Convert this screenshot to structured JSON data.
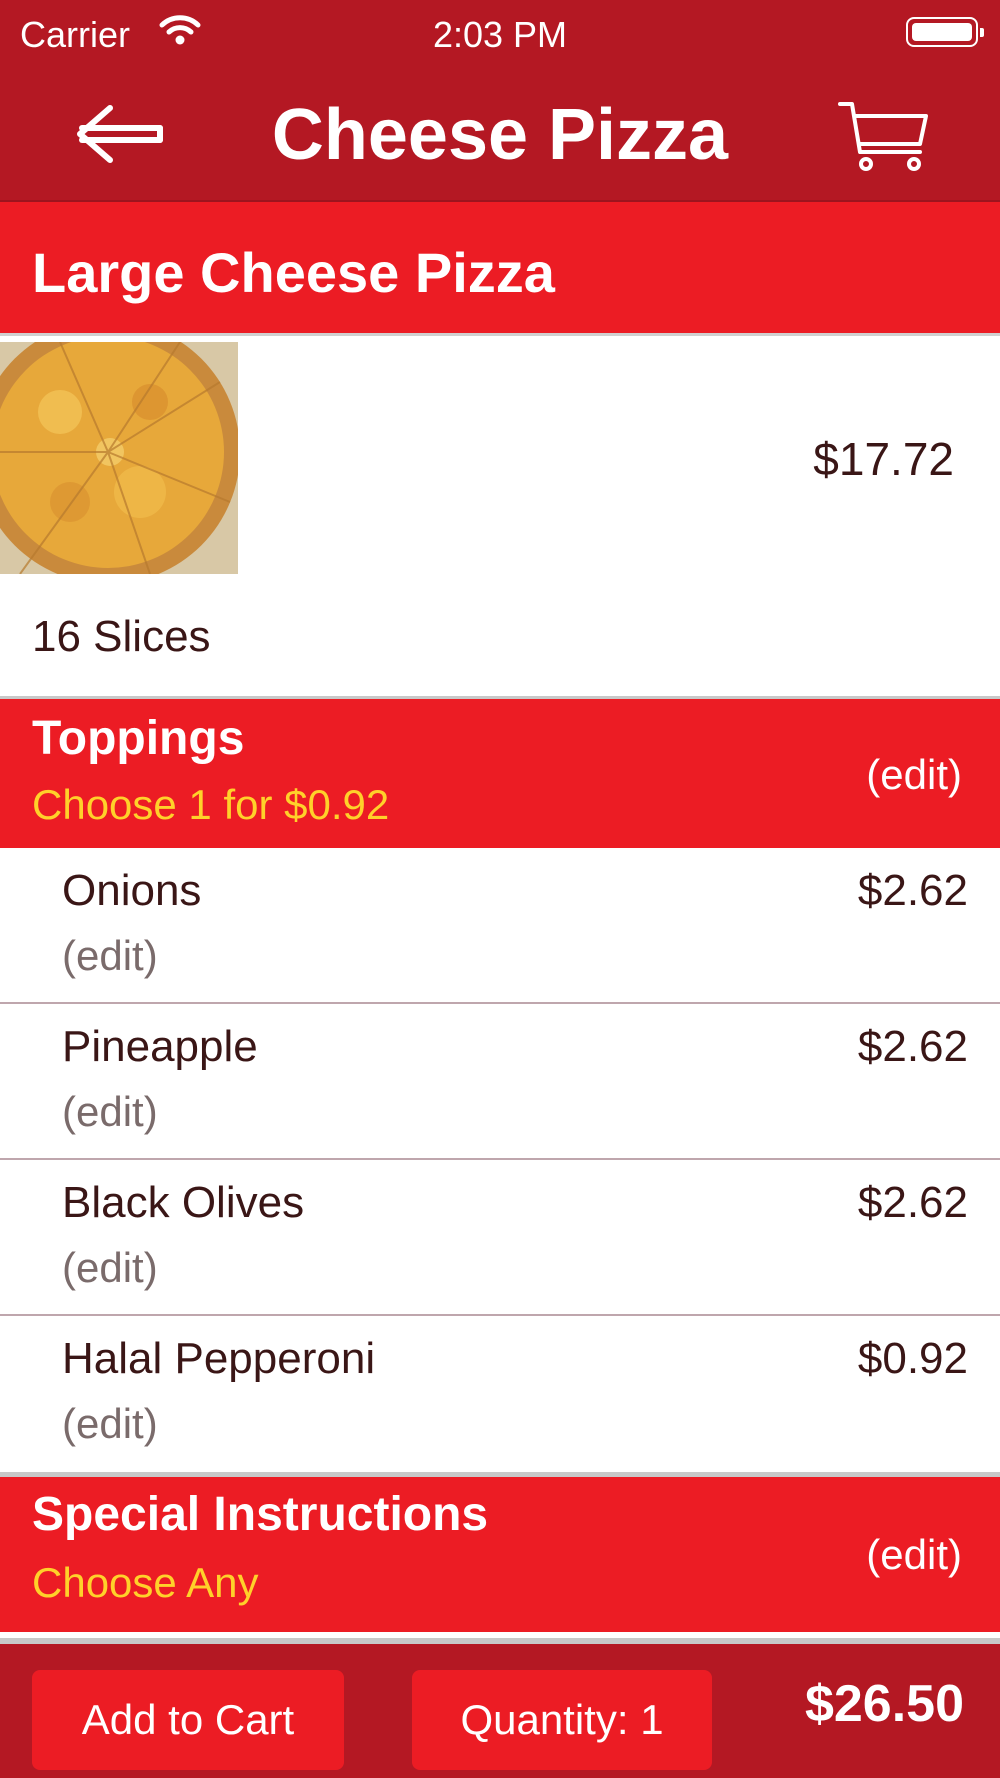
{
  "status_bar": {
    "carrier": "Carrier",
    "time": "2:03 PM"
  },
  "nav": {
    "title": "Cheese Pizza",
    "back_icon": "back-arrow-icon",
    "cart_icon": "cart-icon"
  },
  "item": {
    "title": "Large Cheese Pizza",
    "price": "$17.72",
    "slices": "16 Slices"
  },
  "toppings_section": {
    "title": "Toppings",
    "subtitle": "Choose 1 for $0.92",
    "edit_label": "(edit)"
  },
  "toppings": [
    {
      "name": "Onions",
      "edit_label": "(edit)",
      "price": "$2.62"
    },
    {
      "name": "Pineapple",
      "edit_label": "(edit)",
      "price": "$2.62"
    },
    {
      "name": "Black Olives",
      "edit_label": "(edit)",
      "price": "$2.62"
    },
    {
      "name": "Halal Pepperoni",
      "edit_label": "(edit)",
      "price": "$0.92"
    }
  ],
  "instructions_section": {
    "title": "Special Instructions",
    "subtitle": "Choose Any",
    "edit_label": "(edit)"
  },
  "footer": {
    "add_to_cart_label": "Add to Cart",
    "quantity_label": "Quantity: 1",
    "total": "$26.50"
  },
  "colors": {
    "bar_dark": "#b41823",
    "header_red": "#ec1c24",
    "accent_yellow": "#ffd12a",
    "text_dark": "#3a1616"
  }
}
